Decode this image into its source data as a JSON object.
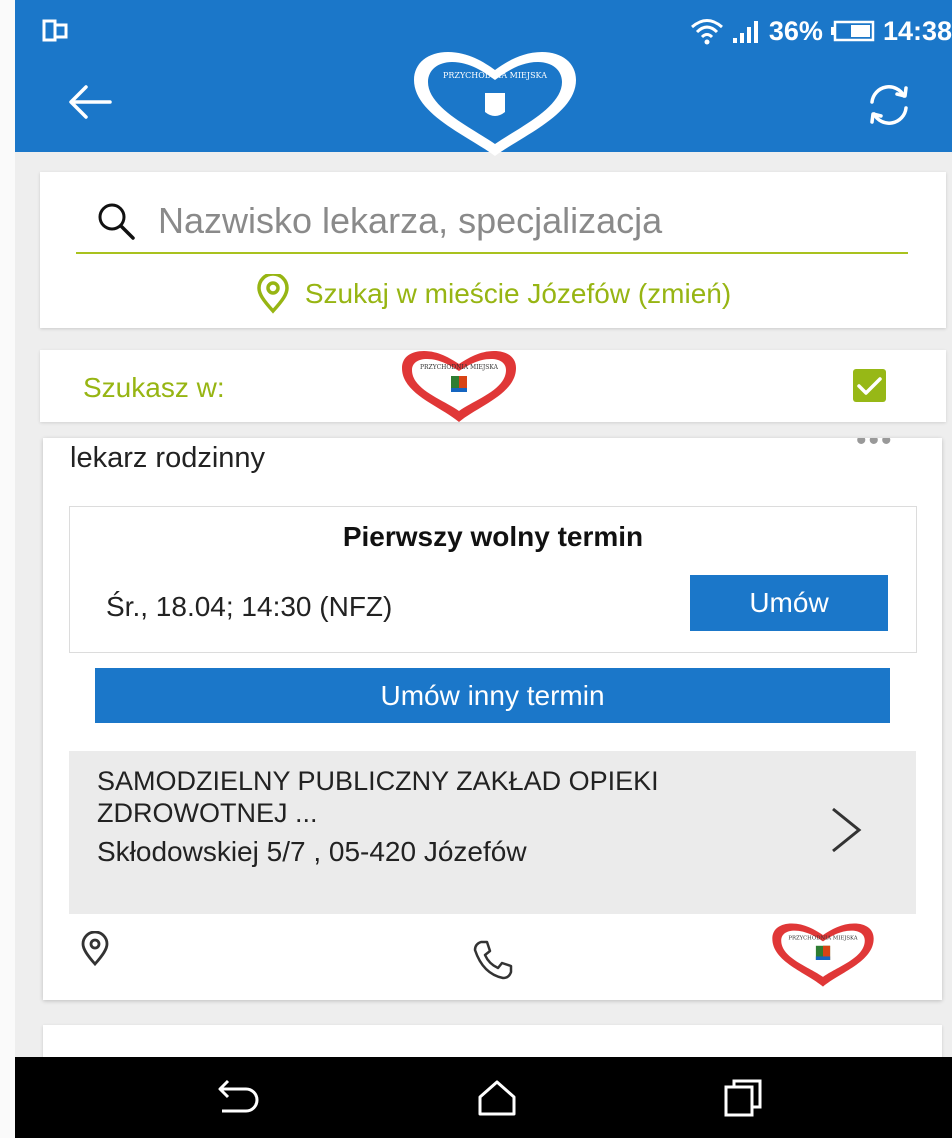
{
  "status_bar": {
    "battery": "36%",
    "time": "14:38",
    "icons": [
      "screen-mirror-icon",
      "wifi-icon",
      "signal-icon",
      "battery-icon"
    ]
  },
  "app_bar": {
    "logo_text": "PRZYCHODNIA MIEJSKA",
    "back_icon": "arrow-left-icon",
    "refresh_icon": "refresh-icon"
  },
  "search": {
    "placeholder": "Nazwisko lekarza, specjalizacja",
    "value": "",
    "city_link": "Szukaj w mieście Józefów (zmień)"
  },
  "filter": {
    "label": "Szukasz w:",
    "logo_text": "PRZYCHODNIA MIEJSKA",
    "checked": true
  },
  "doctor_card": {
    "specialty": "lekarz rodzinny",
    "menu_icon": "more-dots-icon",
    "slot": {
      "title": "Pierwszy wolny termin",
      "datetime": "Śr., 18.04; 14:30 (NFZ)",
      "book_label": "Umów"
    },
    "other_term_label": "Umów inny termin",
    "clinic": {
      "name": "SAMODZIELNY PUBLICZNY ZAKŁAD OPIEKI ZDROWOTNEJ ...",
      "address": "Skłodowskiej 5/7 , 05-420 Józefów"
    },
    "logo_text": "PRZYCHODNIA MIEJSKA"
  },
  "colors": {
    "primary": "#1b77c9",
    "accent_green": "#97b513",
    "heart_red": "#e03737"
  }
}
